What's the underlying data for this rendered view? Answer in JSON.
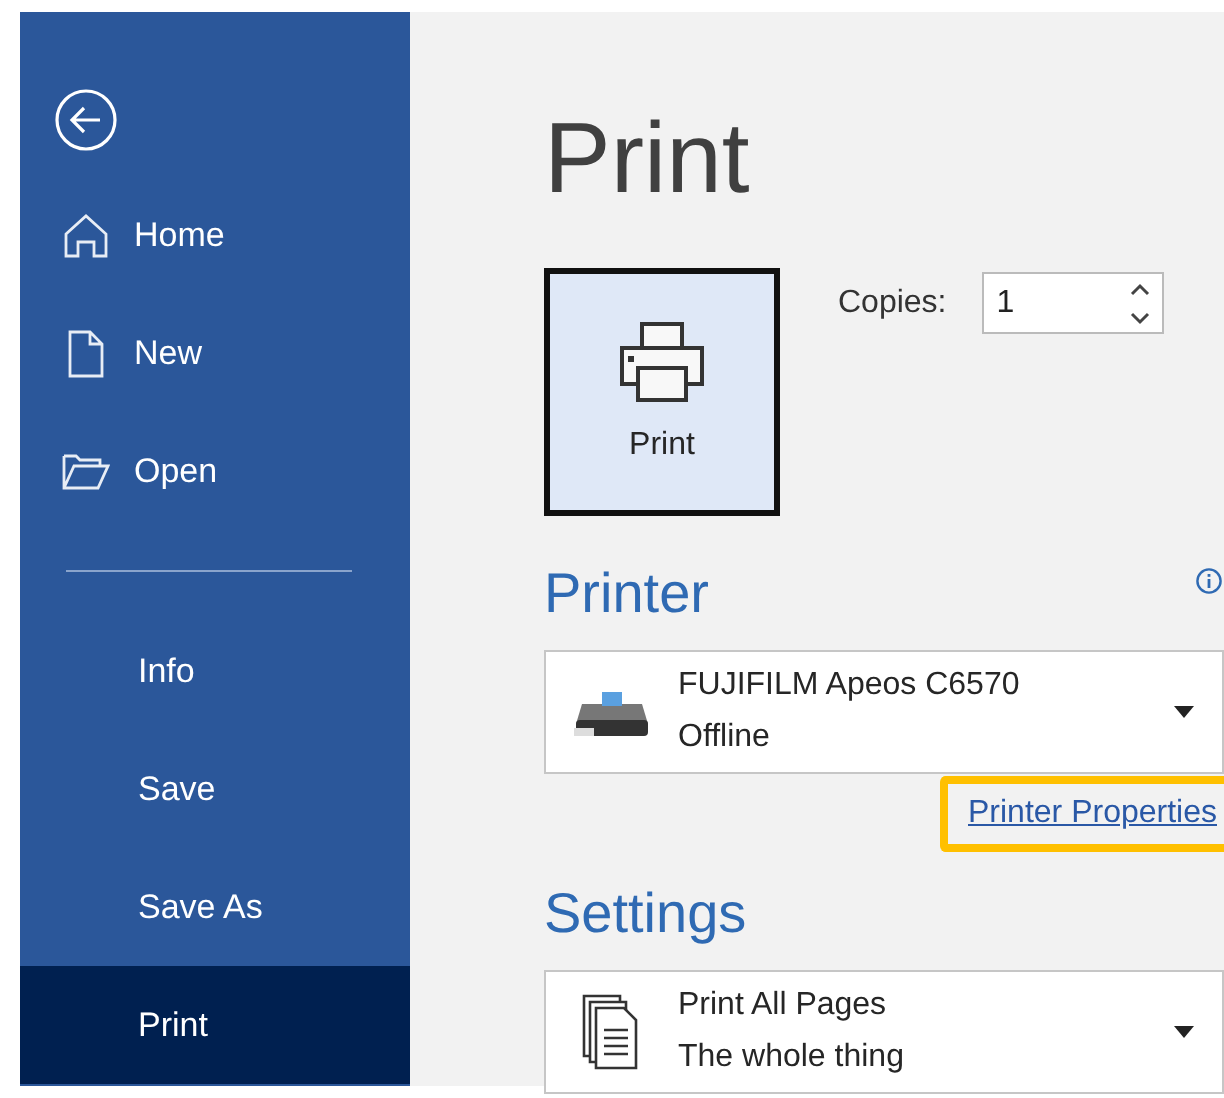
{
  "sidebar": {
    "items": [
      {
        "kind": "back"
      },
      {
        "kind": "home",
        "label": "Home",
        "selected": false
      },
      {
        "kind": "new",
        "label": "New",
        "selected": false
      },
      {
        "kind": "open",
        "label": "Open",
        "selected": false
      },
      {
        "kind": "divider"
      },
      {
        "kind": "plain",
        "label": "Info",
        "selected": false
      },
      {
        "kind": "plain",
        "label": "Save",
        "selected": false
      },
      {
        "kind": "plain",
        "label": "Save As",
        "selected": false
      },
      {
        "kind": "plain",
        "label": "Print",
        "selected": true
      }
    ]
  },
  "page_title": "Print",
  "print_button": {
    "label": "Print"
  },
  "copies": {
    "label": "Copies:",
    "value": "1"
  },
  "printer": {
    "heading": "Printer",
    "name": "FUJIFILM Apeos C6570",
    "status": "Offline",
    "properties_link": "Printer Properties",
    "highlighted": true
  },
  "settings": {
    "heading": "Settings",
    "title": "Print All Pages",
    "subtitle": "The whole thing"
  }
}
